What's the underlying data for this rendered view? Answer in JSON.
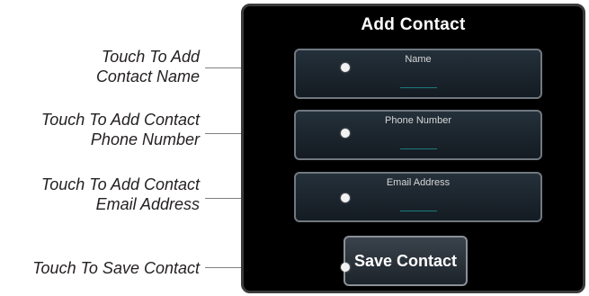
{
  "panel": {
    "title": "Add Contact",
    "fields": [
      {
        "label": "Name",
        "value": "_____"
      },
      {
        "label": "Phone Number",
        "value": "_____"
      },
      {
        "label": "Email Address",
        "value": "_____"
      }
    ],
    "save_label": "Save Contact"
  },
  "callouts": {
    "name_line1": "Touch To Add",
    "name_line2": "Contact Name",
    "phone_line1": "Touch To Add Contact",
    "phone_line2": "Phone Number",
    "email_line1": "Touch To Add Contact",
    "email_line2": "Email Address",
    "save": "Touch To Save Contact"
  },
  "colors": {
    "panel_bg": "#000000",
    "placeholder": "#1fb5b5",
    "callout_text": "#231f20"
  }
}
